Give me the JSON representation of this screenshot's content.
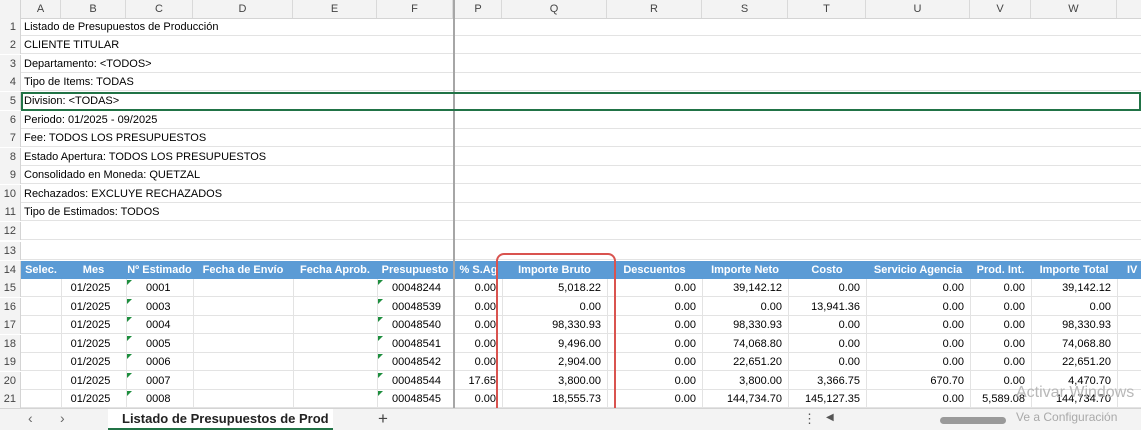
{
  "columns": [
    "A",
    "B",
    "C",
    "D",
    "E",
    "F",
    "P",
    "Q",
    "R",
    "S",
    "T",
    "U",
    "V",
    "W"
  ],
  "row_numbers": [
    "1",
    "2",
    "3",
    "4",
    "5",
    "6",
    "7",
    "8",
    "9",
    "10",
    "11",
    "12",
    "13",
    "14",
    "15",
    "16",
    "17",
    "18",
    "19",
    "20",
    "21"
  ],
  "info_lines": [
    "Listado de Presupuestos de Producción",
    "CLIENTE TITULAR",
    "Departamento: <TODOS>",
    "Tipo de Items: TODAS",
    "Division: <TODAS>",
    "Periodo: 01/2025 - 09/2025",
    "Fee: TODOS LOS PRESUPUESTOS",
    "Estado Apertura: TODOS LOS PRESUPUESTOS",
    "Consolidado en Moneda: QUETZAL",
    "Rechazados: EXCLUYE RECHAZADOS",
    "Tipo de Estimados: TODOS"
  ],
  "table_headers": [
    "Selec.",
    "Mes",
    "Nº Estimado",
    "Fecha de Envío",
    "Fecha Aprob.",
    "Presupuesto",
    "% S.Ag",
    "Importe Bruto",
    "Descuentos",
    "Importe Neto",
    "Costo",
    "Servicio Agencia",
    "Prod. Int.",
    "Importe Total",
    "IV"
  ],
  "rows": [
    {
      "mes": "01/2025",
      "estimado": "0001",
      "presupuesto": "00048244",
      "sag": "0.00",
      "bruto": "5,018.22",
      "desc": "0.00",
      "neto": "39,142.12",
      "costo": "0.00",
      "servicio": "0.00",
      "prod": "0.00",
      "total": "39,142.12"
    },
    {
      "mes": "01/2025",
      "estimado": "0003",
      "presupuesto": "00048539",
      "sag": "0.00",
      "bruto": "0.00",
      "desc": "0.00",
      "neto": "0.00",
      "costo": "13,941.36",
      "servicio": "0.00",
      "prod": "0.00",
      "total": "0.00"
    },
    {
      "mes": "01/2025",
      "estimado": "0004",
      "presupuesto": "00048540",
      "sag": "0.00",
      "bruto": "98,330.93",
      "desc": "0.00",
      "neto": "98,330.93",
      "costo": "0.00",
      "servicio": "0.00",
      "prod": "0.00",
      "total": "98,330.93"
    },
    {
      "mes": "01/2025",
      "estimado": "0005",
      "presupuesto": "00048541",
      "sag": "0.00",
      "bruto": "9,496.00",
      "desc": "0.00",
      "neto": "74,068.80",
      "costo": "0.00",
      "servicio": "0.00",
      "prod": "0.00",
      "total": "74,068.80"
    },
    {
      "mes": "01/2025",
      "estimado": "0006",
      "presupuesto": "00048542",
      "sag": "0.00",
      "bruto": "2,904.00",
      "desc": "0.00",
      "neto": "22,651.20",
      "costo": "0.00",
      "servicio": "0.00",
      "prod": "0.00",
      "total": "22,651.20"
    },
    {
      "mes": "01/2025",
      "estimado": "0007",
      "presupuesto": "00048544",
      "sag": "17.65",
      "bruto": "3,800.00",
      "desc": "0.00",
      "neto": "3,800.00",
      "costo": "3,366.75",
      "servicio": "670.70",
      "prod": "0.00",
      "total": "4,470.70"
    },
    {
      "mes": "01/2025",
      "estimado": "0008",
      "presupuesto": "00048545",
      "sag": "0.00",
      "bruto": "18,555.73",
      "desc": "0.00",
      "neto": "144,734.70",
      "costo": "145,127.35",
      "servicio": "0.00",
      "prod": "5,589.08",
      "total": "144,734.70"
    }
  ],
  "sheet_tab": "Listado de Presupuestos de Prod",
  "add_sheet": "+",
  "watermark": {
    "line1": "Activar Windows",
    "line2": "Ve a Configuración"
  },
  "colors": {
    "header_blue": "#5b9bd5",
    "highlight_red": "#d9534f",
    "excel_green": "#217346"
  }
}
